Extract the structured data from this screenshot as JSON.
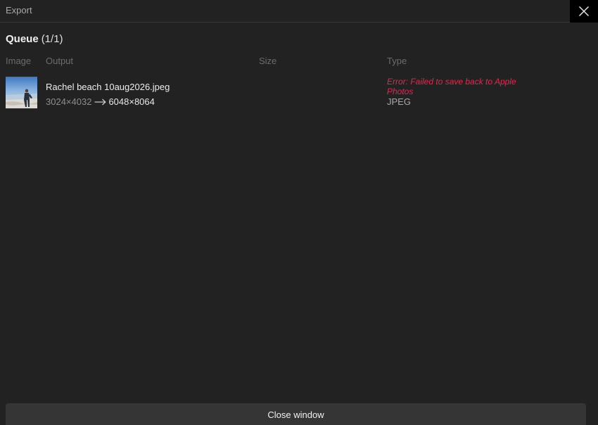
{
  "window": {
    "title": "Export",
    "close_icon": "close-icon"
  },
  "queue": {
    "title": "Queue",
    "count": "(1/1)"
  },
  "columns": {
    "image": "Image",
    "output": "Output",
    "size": "Size",
    "type": "Type"
  },
  "items": [
    {
      "filename": "Rachel beach 10aug2026.jpeg",
      "from_dims": "3024×4032",
      "to_dims": "6048×8064",
      "arrow_icon": "arrow-right-icon",
      "error": "Error: Failed to save back to Apple Photos",
      "type": "JPEG"
    }
  ],
  "footer": {
    "close_label": "Close window"
  },
  "colors": {
    "background": "#222222",
    "error": "#e3274f",
    "button": "#353535"
  }
}
